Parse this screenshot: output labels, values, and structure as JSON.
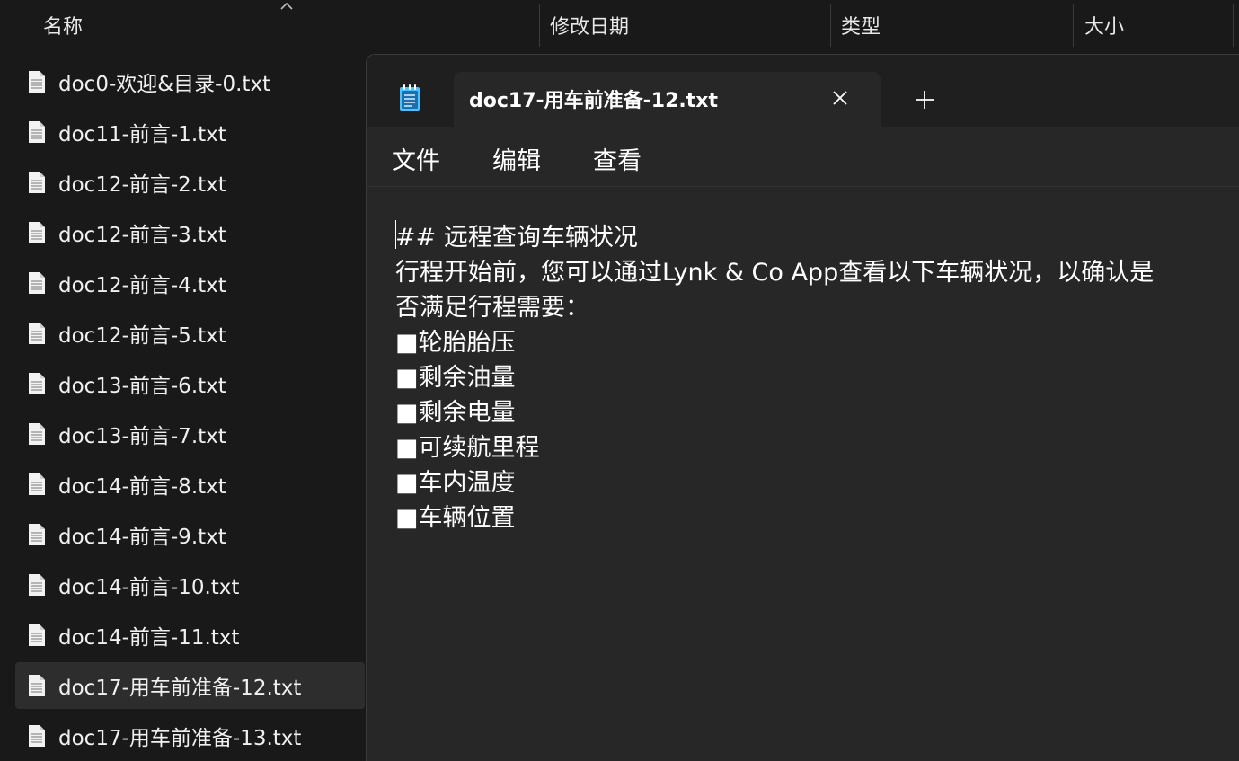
{
  "explorer": {
    "columns": {
      "name": "名称",
      "modified": "修改日期",
      "type": "类型",
      "size": "大小"
    },
    "files": [
      "doc0-欢迎&目录-0.txt",
      "doc11-前言-1.txt",
      "doc12-前言-2.txt",
      "doc12-前言-3.txt",
      "doc12-前言-4.txt",
      "doc12-前言-5.txt",
      "doc13-前言-6.txt",
      "doc13-前言-7.txt",
      "doc14-前言-8.txt",
      "doc14-前言-9.txt",
      "doc14-前言-10.txt",
      "doc14-前言-11.txt",
      "doc17-用车前准备-12.txt",
      "doc17-用车前准备-13.txt"
    ],
    "selected_file": "doc17-用车前准备-12.txt",
    "file_icon": "text-file-icon",
    "sort_icon": "chevron-up-icon"
  },
  "notepad": {
    "app_icon": "notepad-icon",
    "tab_title": "doc17-用车前准备-12.txt",
    "close_icon": "close-icon",
    "new_tab_icon": "plus-icon",
    "menu": {
      "file": "文件",
      "edit": "编辑",
      "view": "查看"
    },
    "lines": [
      "## 远程查询车辆状况",
      "行程开始前，您可以通过Lynk & Co App查看以下车辆状况，以确认是",
      "否满足行程需要：",
      "■轮胎胎压",
      "■剩余油量",
      "■剩余电量",
      "■可续航里程",
      "■车内温度",
      "■车辆位置"
    ]
  },
  "colors": {
    "explorer_bg": "#191919",
    "notepad_bg": "#272727",
    "titlebar_bg": "#1f1f1f",
    "selected_row": "#2d2d2d",
    "notepad_icon_accent": "#4cc2ff"
  }
}
